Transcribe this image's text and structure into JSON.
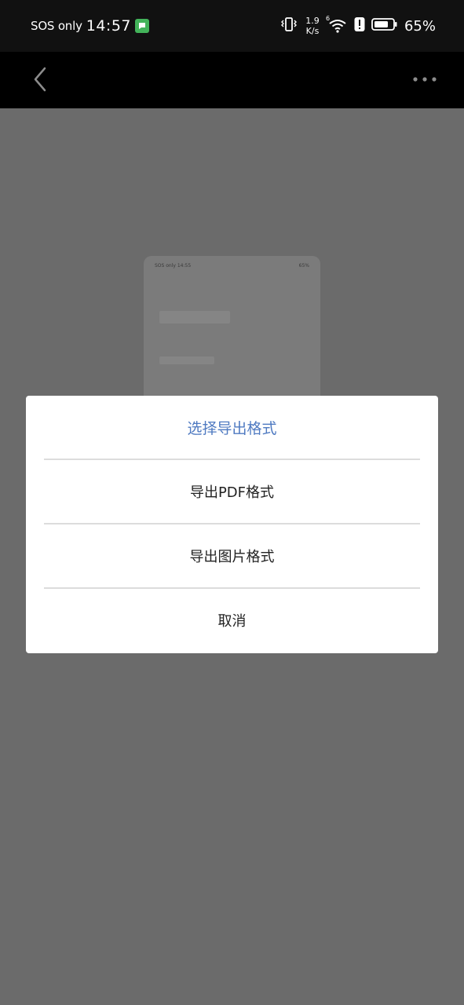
{
  "status_bar": {
    "carrier": "SOS only",
    "time": "14:57",
    "net_speed_value": "1.9",
    "net_speed_unit": "K/s",
    "wifi_badge": "6",
    "battery": "65%"
  },
  "toolbar": {
    "back_icon": "chevron-left-icon",
    "more_icon": "more-horizontal-icon"
  },
  "thumbnail": {
    "status_left": "SOS only 14:55",
    "status_right": "65%"
  },
  "dialog": {
    "title": "选择导出格式",
    "options": [
      {
        "label": "导出PDF格式"
      },
      {
        "label": "导出图片格式"
      },
      {
        "label": "取消"
      }
    ]
  },
  "colors": {
    "title_accent": "#4f7ac1",
    "overlay": "#6b6b6b",
    "status_bg": "#111111",
    "toolbar_bg": "#000000"
  }
}
